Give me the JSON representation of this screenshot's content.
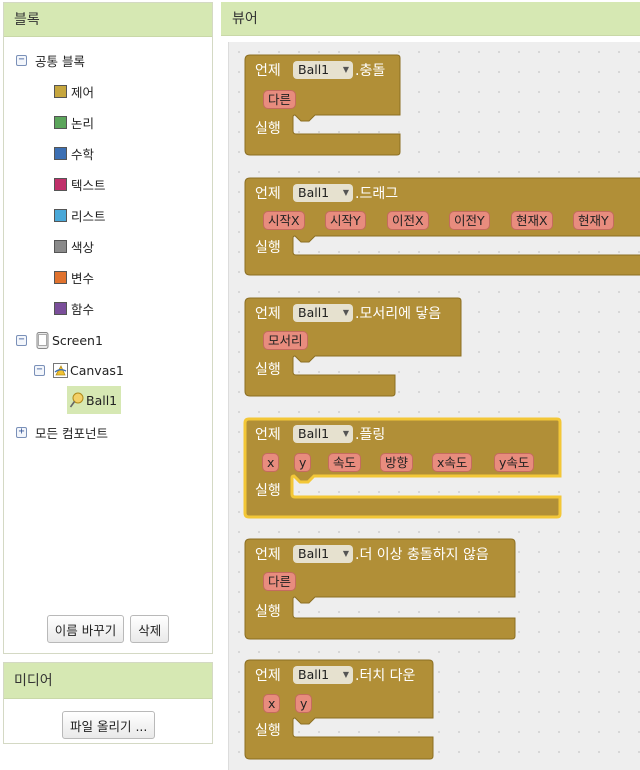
{
  "blocks_panel": {
    "title": "블록",
    "builtin": {
      "label": "공통 블록",
      "toggle": "−",
      "categories": [
        {
          "label": "제어",
          "color": "#c6a63e"
        },
        {
          "label": "논리",
          "color": "#5ba55b"
        },
        {
          "label": "수학",
          "color": "#3c6fb3"
        },
        {
          "label": "텍스트",
          "color": "#c0306a"
        },
        {
          "label": "리스트",
          "color": "#4aa8d8"
        },
        {
          "label": "색상",
          "color": "#8a8a8a"
        },
        {
          "label": "변수",
          "color": "#e0722e"
        },
        {
          "label": "함수",
          "color": "#7a4e9a"
        }
      ]
    },
    "screen": {
      "label": "Screen1",
      "toggle": "−"
    },
    "canvas": {
      "label": "Canvas1",
      "toggle": "−"
    },
    "ball": {
      "label": "Ball1"
    },
    "any_component": {
      "label": "모든 컴포넌트",
      "toggle": "+"
    },
    "rename_button": "이름 바꾸기",
    "delete_button": "삭제"
  },
  "media_panel": {
    "title": "미디어",
    "upload_button": "파일 올리기 ..."
  },
  "viewer": {
    "title": "뷰어",
    "colors": {
      "block": "#b18f37",
      "block_border": "#8c6f22",
      "selected_border": "#f3c737"
    },
    "blocks": [
      {
        "when": "언제",
        "component": "Ball1",
        "event": ".충돌",
        "params": [
          "다른"
        ],
        "do": "실행"
      },
      {
        "when": "언제",
        "component": "Ball1",
        "event": ".드래그",
        "params": [
          "시작X",
          "시작Y",
          "이전X",
          "이전Y",
          "현재X",
          "현재Y"
        ],
        "do": "실행"
      },
      {
        "when": "언제",
        "component": "Ball1",
        "event": ".모서리에 닿음",
        "params": [
          "모서리"
        ],
        "do": "실행"
      },
      {
        "when": "언제",
        "component": "Ball1",
        "event": ".플링",
        "params": [
          "x",
          "y",
          "속도",
          "방향",
          "x속도",
          "y속도"
        ],
        "do": "실행"
      },
      {
        "when": "언제",
        "component": "Ball1",
        "event": ".더 이상 충돌하지 않음",
        "params": [
          "다른"
        ],
        "do": "실행"
      },
      {
        "when": "언제",
        "component": "Ball1",
        "event": ".터치 다운",
        "params": [
          "x",
          "y"
        ],
        "do": "실행"
      }
    ]
  }
}
